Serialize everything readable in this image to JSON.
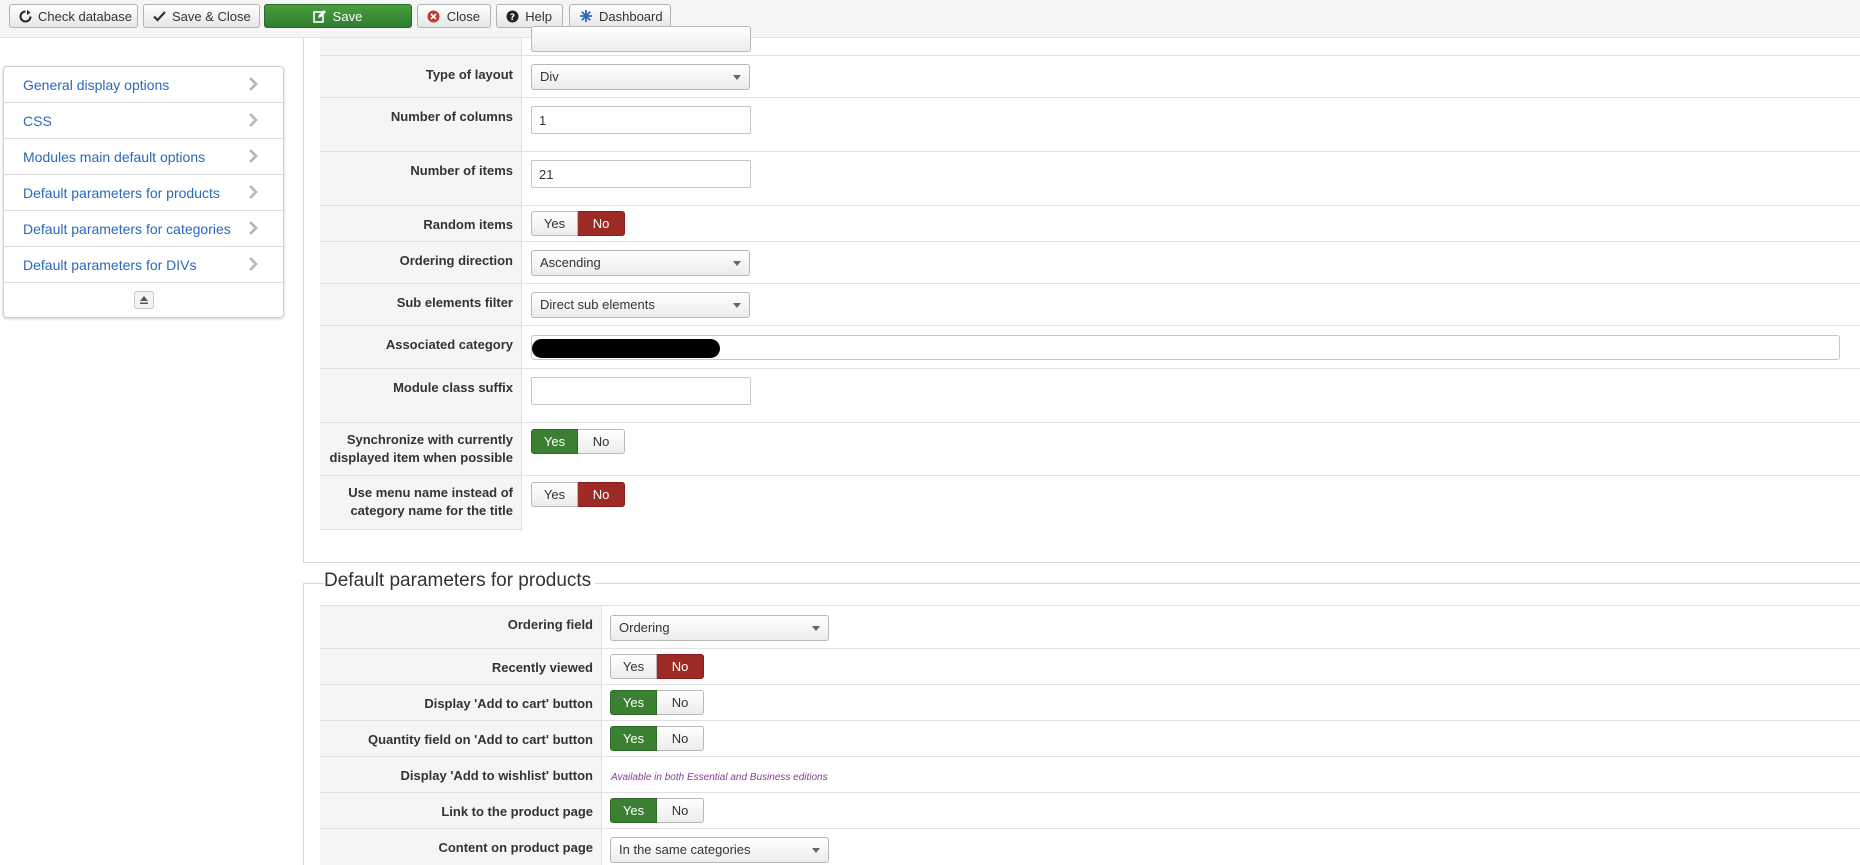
{
  "toolbar": {
    "check_database": "Check database",
    "save_close": "Save & Close",
    "save": "Save",
    "close": "Close",
    "help": "Help",
    "dashboard": "Dashboard"
  },
  "sidebar": {
    "items": [
      {
        "label": "General display options"
      },
      {
        "label": "CSS"
      },
      {
        "label": "Modules main default options"
      },
      {
        "label": "Default parameters for products"
      },
      {
        "label": "Default parameters for categories"
      },
      {
        "label": "Default parameters for DIVs"
      }
    ]
  },
  "module": {
    "type_of_layout": {
      "label": "Type of layout",
      "value": "Div"
    },
    "number_of_columns": {
      "label": "Number of columns",
      "value": "1"
    },
    "number_of_items": {
      "label": "Number of items",
      "value": "21"
    },
    "random_items": {
      "label": "Random items",
      "yes": "Yes",
      "no": "No",
      "selected": "No"
    },
    "ordering_direction": {
      "label": "Ordering direction",
      "value": "Ascending"
    },
    "sub_elements_filter": {
      "label": "Sub elements filter",
      "value": "Direct sub elements"
    },
    "associated_category": {
      "label": "Associated category",
      "value": ""
    },
    "module_class_suffix": {
      "label": "Module class suffix",
      "value": ""
    },
    "synchronize": {
      "label": "Synchronize with currently displayed item when possible",
      "yes": "Yes",
      "no": "No",
      "selected": "Yes"
    },
    "use_menu_name": {
      "label": "Use menu name instead of category name for the title",
      "yes": "Yes",
      "no": "No",
      "selected": "No"
    }
  },
  "products": {
    "section_title": "Default parameters for products",
    "ordering_field": {
      "label": "Ordering field",
      "value": "Ordering"
    },
    "recently_viewed": {
      "label": "Recently viewed",
      "yes": "Yes",
      "no": "No",
      "selected": "No"
    },
    "add_to_cart": {
      "label": "Display 'Add to cart' button",
      "yes": "Yes",
      "no": "No",
      "selected": "Yes"
    },
    "quantity_field": {
      "label": "Quantity field on 'Add to cart' button",
      "yes": "Yes",
      "no": "No",
      "selected": "Yes"
    },
    "wishlist": {
      "label": "Display 'Add to wishlist' button",
      "note": "Available in both Essential and Business editions"
    },
    "link_product_page": {
      "label": "Link to the product page",
      "yes": "Yes",
      "no": "No",
      "selected": "Yes"
    },
    "content_product_page": {
      "label": "Content on product page",
      "value": "In the same categories"
    }
  },
  "colors": {
    "green": "#3b7f33",
    "red": "#9d2a25",
    "link": "#2a69b8",
    "note": "#8a3c9b"
  }
}
